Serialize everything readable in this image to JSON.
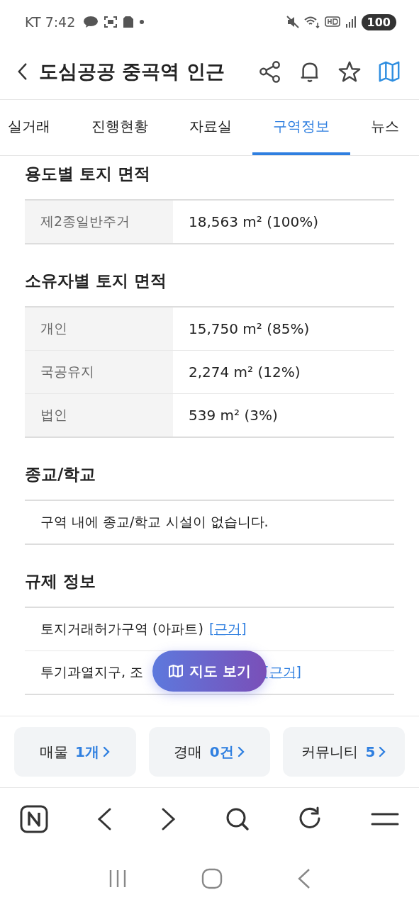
{
  "status_bar": {
    "carrier_time": "KT 7:42",
    "battery": "100"
  },
  "header": {
    "title": "도심공공 중곡역 인근"
  },
  "tabs": [
    {
      "label": "실거래",
      "selected": false
    },
    {
      "label": "진행현황",
      "selected": false
    },
    {
      "label": "자료실",
      "selected": false
    },
    {
      "label": "구역정보",
      "selected": true
    },
    {
      "label": "뉴스",
      "selected": false
    }
  ],
  "sections": [
    {
      "title": "용도별 토지 면적",
      "kind": "table",
      "rows": [
        {
          "label": "제2종일반주거",
          "value": "18,563 m² (100%)"
        }
      ]
    },
    {
      "title": "소유자별 토지 면적",
      "kind": "table",
      "rows": [
        {
          "label": "개인",
          "value": "15,750 m² (85%)"
        },
        {
          "label": "국공유지",
          "value": "2,274 m² (12%)"
        },
        {
          "label": "법인",
          "value": "539 m² (3%)"
        }
      ]
    },
    {
      "title": "종교/학교",
      "kind": "list",
      "items": [
        {
          "text": "구역 내에 종교/학교 시설이 없습니다."
        }
      ]
    },
    {
      "title": "규제 정보",
      "kind": "list",
      "items": [
        {
          "text": "토지거래허가구역 (아파트)",
          "link": "[근거]"
        },
        {
          "text": "투기과열지구, 조",
          "link": "[근거]"
        }
      ]
    }
  ],
  "map_button": {
    "label": "지도 보기"
  },
  "summary_buttons": [
    {
      "label": "매물",
      "count": "1개"
    },
    {
      "label": "경매",
      "count": "0건"
    },
    {
      "label": "커뮤니티",
      "count": "5"
    }
  ]
}
